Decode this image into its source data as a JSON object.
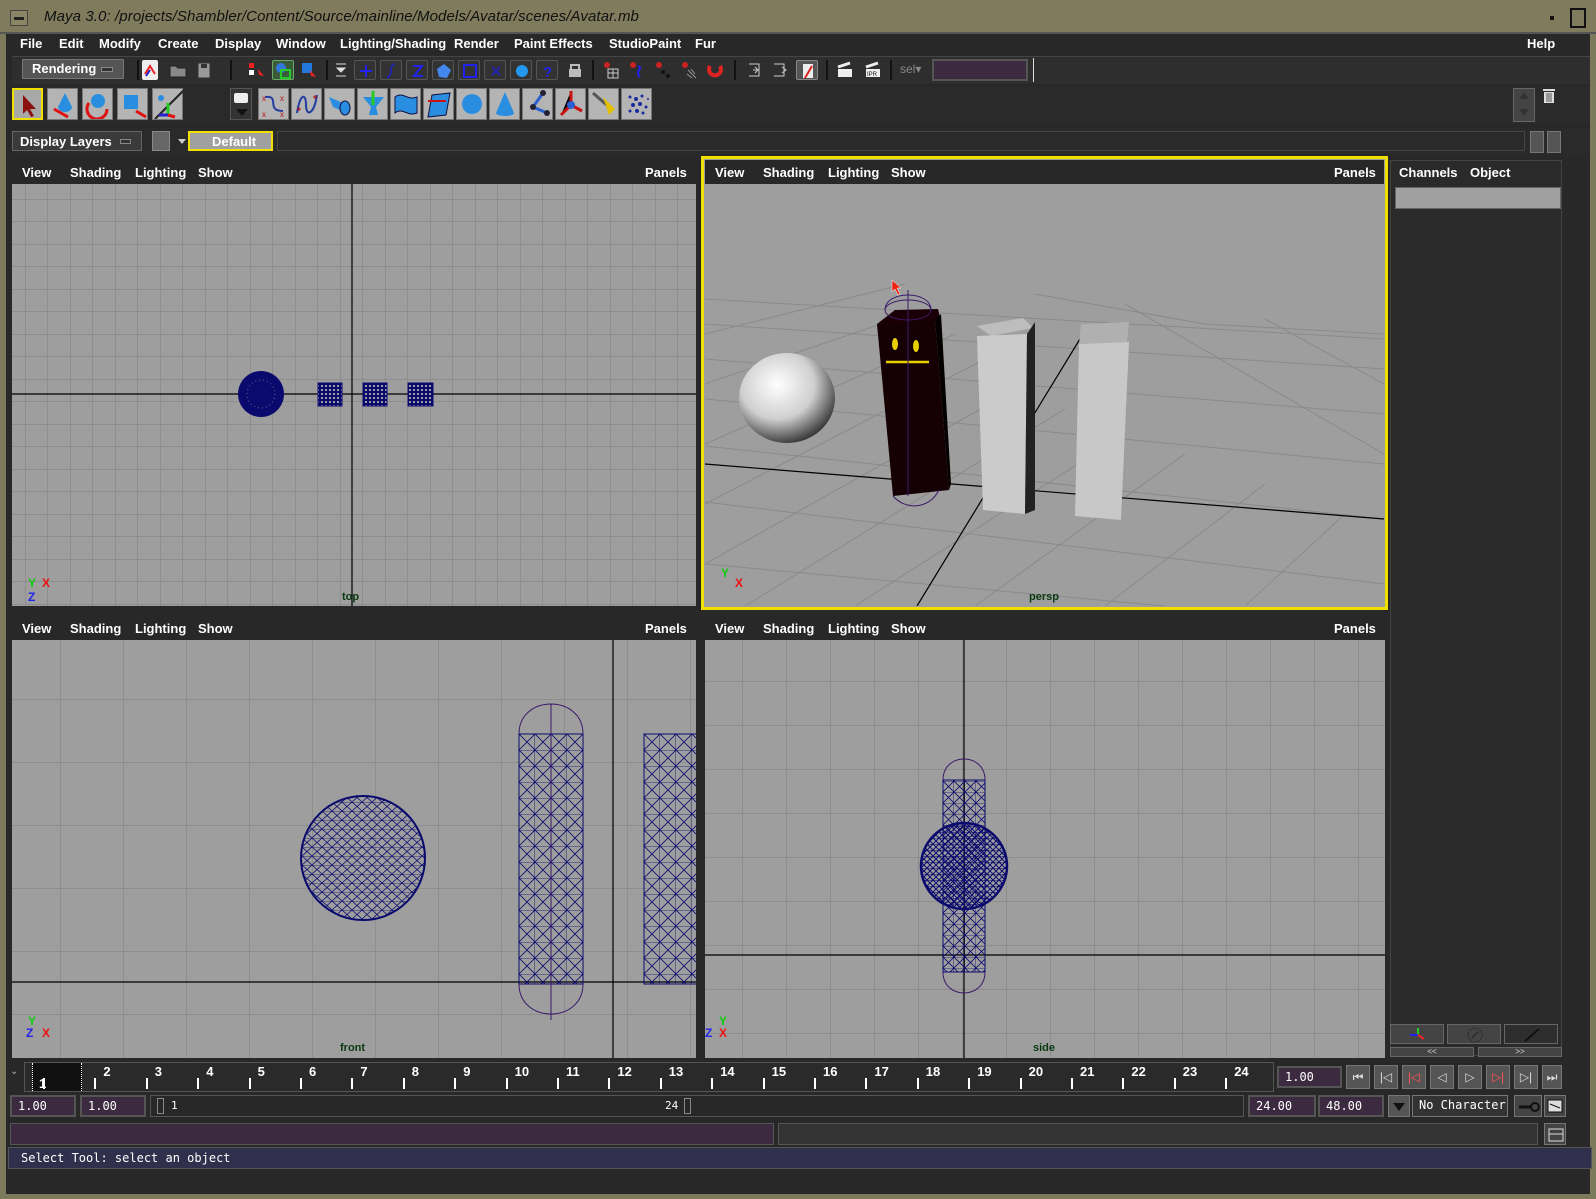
{
  "window": {
    "title": "Maya 3.0: /projects/Shambler/Content/Source/mainline/Models/Avatar/scenes/Avatar.mb"
  },
  "menubar": {
    "items": [
      "File",
      "Edit",
      "Modify",
      "Create",
      "Display",
      "Window",
      "Lighting/Shading",
      "Render",
      "Paint Effects",
      "StudioPaint",
      "Fur"
    ],
    "help": "Help"
  },
  "status_line": {
    "menu_set": "Rendering",
    "selection_label": "sel",
    "selection_field": "",
    "icons": [
      "new-scene-icon",
      "open-scene-icon",
      "save-scene-icon",
      "select-by-hierarchy-icon",
      "select-by-object-icon",
      "select-by-component-icon",
      "snap-grid-icon",
      "snap-curve-icon",
      "snap-point-icon",
      "snap-view-plane-icon",
      "snap-live-icon",
      "snap-pivot-icon",
      "snap-joint-icon",
      "snap-sphere-icon",
      "snap-misc-icon",
      "lock-icon",
      "history-grid-icon",
      "history-curve-icon",
      "history-point-icon",
      "history-mesh-icon",
      "magnet-icon",
      "input-ops-icon",
      "output-ops-icon",
      "render-view-icon",
      "render-icon",
      "ipr-render-icon"
    ]
  },
  "shelf": {
    "tools": [
      {
        "name": "select-tool",
        "active": true
      },
      {
        "name": "move-tool",
        "active": false
      },
      {
        "name": "rotate-tool",
        "active": false
      },
      {
        "name": "scale-tool",
        "active": false
      },
      {
        "name": "manipulator-tool",
        "active": false
      }
    ],
    "items": [
      "cv-curve-icon",
      "ep-curve-icon",
      "extrude-icon",
      "revolve-icon",
      "loft-icon",
      "birail-icon",
      "sphere-icon",
      "cone-icon",
      "joint-icon",
      "ik-handle-icon",
      "paint-icon",
      "particles-icon"
    ]
  },
  "layers": {
    "button_label": "Display Layers",
    "current_layer": "Default"
  },
  "viewports": [
    {
      "id": "top",
      "menus": [
        "View",
        "Shading",
        "Lighting",
        "Show"
      ],
      "panels": "Panels",
      "camera": "top",
      "active": false
    },
    {
      "id": "persp",
      "menus": [
        "View",
        "Shading",
        "Lighting",
        "Show"
      ],
      "panels": "Panels",
      "camera": "persp",
      "active": true
    },
    {
      "id": "front",
      "menus": [
        "View",
        "Shading",
        "Lighting",
        "Show"
      ],
      "panels": "Panels",
      "camera": "front",
      "active": false
    },
    {
      "id": "side",
      "menus": [
        "View",
        "Shading",
        "Lighting",
        "Show"
      ],
      "panels": "Panels",
      "camera": "side",
      "active": false
    }
  ],
  "axes": {
    "x": "X",
    "y": "Y",
    "z": "Z"
  },
  "channel_box": {
    "tabs": [
      "Channels",
      "Object"
    ],
    "nav_prev": "<<",
    "nav_next": ">>"
  },
  "timeline": {
    "ticks": [
      "1",
      "2",
      "3",
      "4",
      "5",
      "6",
      "7",
      "8",
      "9",
      "10",
      "11",
      "12",
      "13",
      "14",
      "15",
      "16",
      "17",
      "18",
      "19",
      "20",
      "21",
      "22",
      "23",
      "24"
    ],
    "current_frame_marker": "1",
    "current_time": "1.00"
  },
  "range": {
    "start_time": "1.00",
    "playback_start": "1.00",
    "range_start_label": "1",
    "range_end_label": "24",
    "playback_end": "24.00",
    "end_time": "48.00"
  },
  "playback": {
    "buttons": [
      "go-to-start",
      "step-back-key",
      "step-back-frame-key",
      "play-backwards",
      "play-forwards",
      "step-forward-frame-key",
      "step-forward-key",
      "go-to-end"
    ]
  },
  "character": {
    "current": "No Character"
  },
  "command_line": {
    "input": "",
    "result": ""
  },
  "help_line": {
    "text": "Select Tool: select an object"
  },
  "colors": {
    "active_outline": "#f0e000",
    "viewport_bg": "#9e9e9e",
    "wireframe": "#0a0a6e",
    "field_bg": "#3c2a40",
    "helpline_bg": "#30304c"
  }
}
